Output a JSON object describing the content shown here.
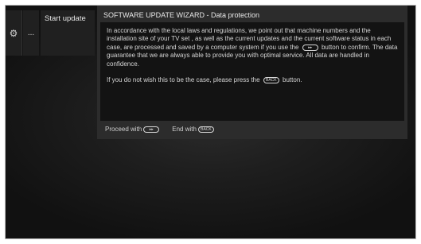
{
  "menu": {
    "settings_icon": "gear-icon",
    "more_label": "...",
    "start_update_label": "Start update"
  },
  "dialog": {
    "title": "SOFTWARE UPDATE WIZARD - Data protection",
    "para1_before": "In accordance with the local laws and regulations, we point out that machine numbers and the installation site of your TV set , as well as the current updates and the current software status in each case, are processed and saved by a computer system if you use the",
    "para1_after": "button to confirm. The data guarantee that we are always able to provide you with optimal service. All data are handled in confidence.",
    "para2_before": "If you do not wish this to be the case, please press the",
    "para2_after": "button.",
    "forward_button_glyph": "▸▸",
    "back_button_glyph": "BACK",
    "footer": {
      "proceed_label": "Proceed with",
      "end_label": "End with"
    }
  }
}
